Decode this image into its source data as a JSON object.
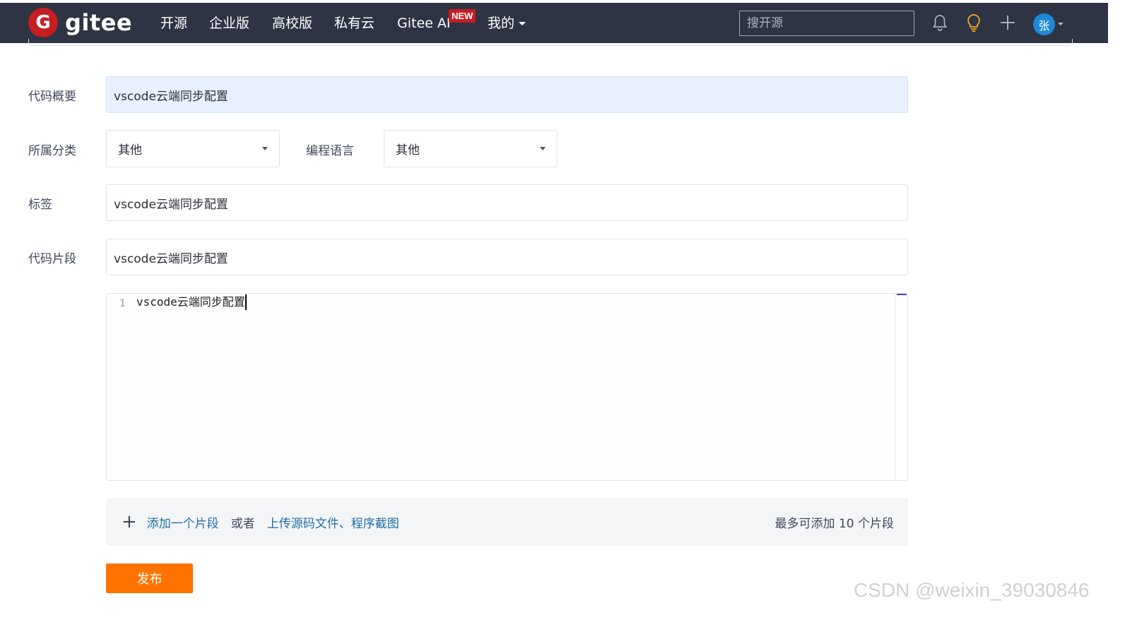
{
  "nav": {
    "logo_text": "gitee",
    "logo_glyph": "G",
    "items": [
      "开源",
      "企业版",
      "高校版",
      "私有云",
      "Gitee AI",
      "我的"
    ],
    "new_badge": "NEW",
    "search_placeholder": "搜开源",
    "avatar_letter": "张",
    "icons": [
      "bell-icon",
      "lightbulb-icon",
      "plus-icon",
      "chevron-down-icon"
    ]
  },
  "form": {
    "summary": {
      "label": "代码概要",
      "value": "vscode云端同步配置"
    },
    "category": {
      "label": "所属分类",
      "value": "其他"
    },
    "language": {
      "label": "编程语言",
      "value": "其他"
    },
    "tags": {
      "label": "标签",
      "value": "vscode云端同步配置"
    },
    "snippet": {
      "label": "代码片段",
      "filename": "vscode云端同步配置"
    },
    "editor": {
      "line_number": "1",
      "line_text": "vscode云端同步配置"
    },
    "snippet_bar": {
      "add_link": "添加一个片段",
      "or_text": "或者",
      "upload_link": "上传源码文件、程序截图",
      "limit_text": "最多可添加 10 个片段"
    },
    "publish_label": "发布"
  },
  "watermark": "CSDN @weixin_39030846",
  "colors": {
    "navbar": "#2e3443",
    "brand_red": "#c71d23",
    "publish_orange": "#fe7300",
    "link_blue": "#1f6ea8",
    "avatar_blue": "#1e88d8"
  }
}
